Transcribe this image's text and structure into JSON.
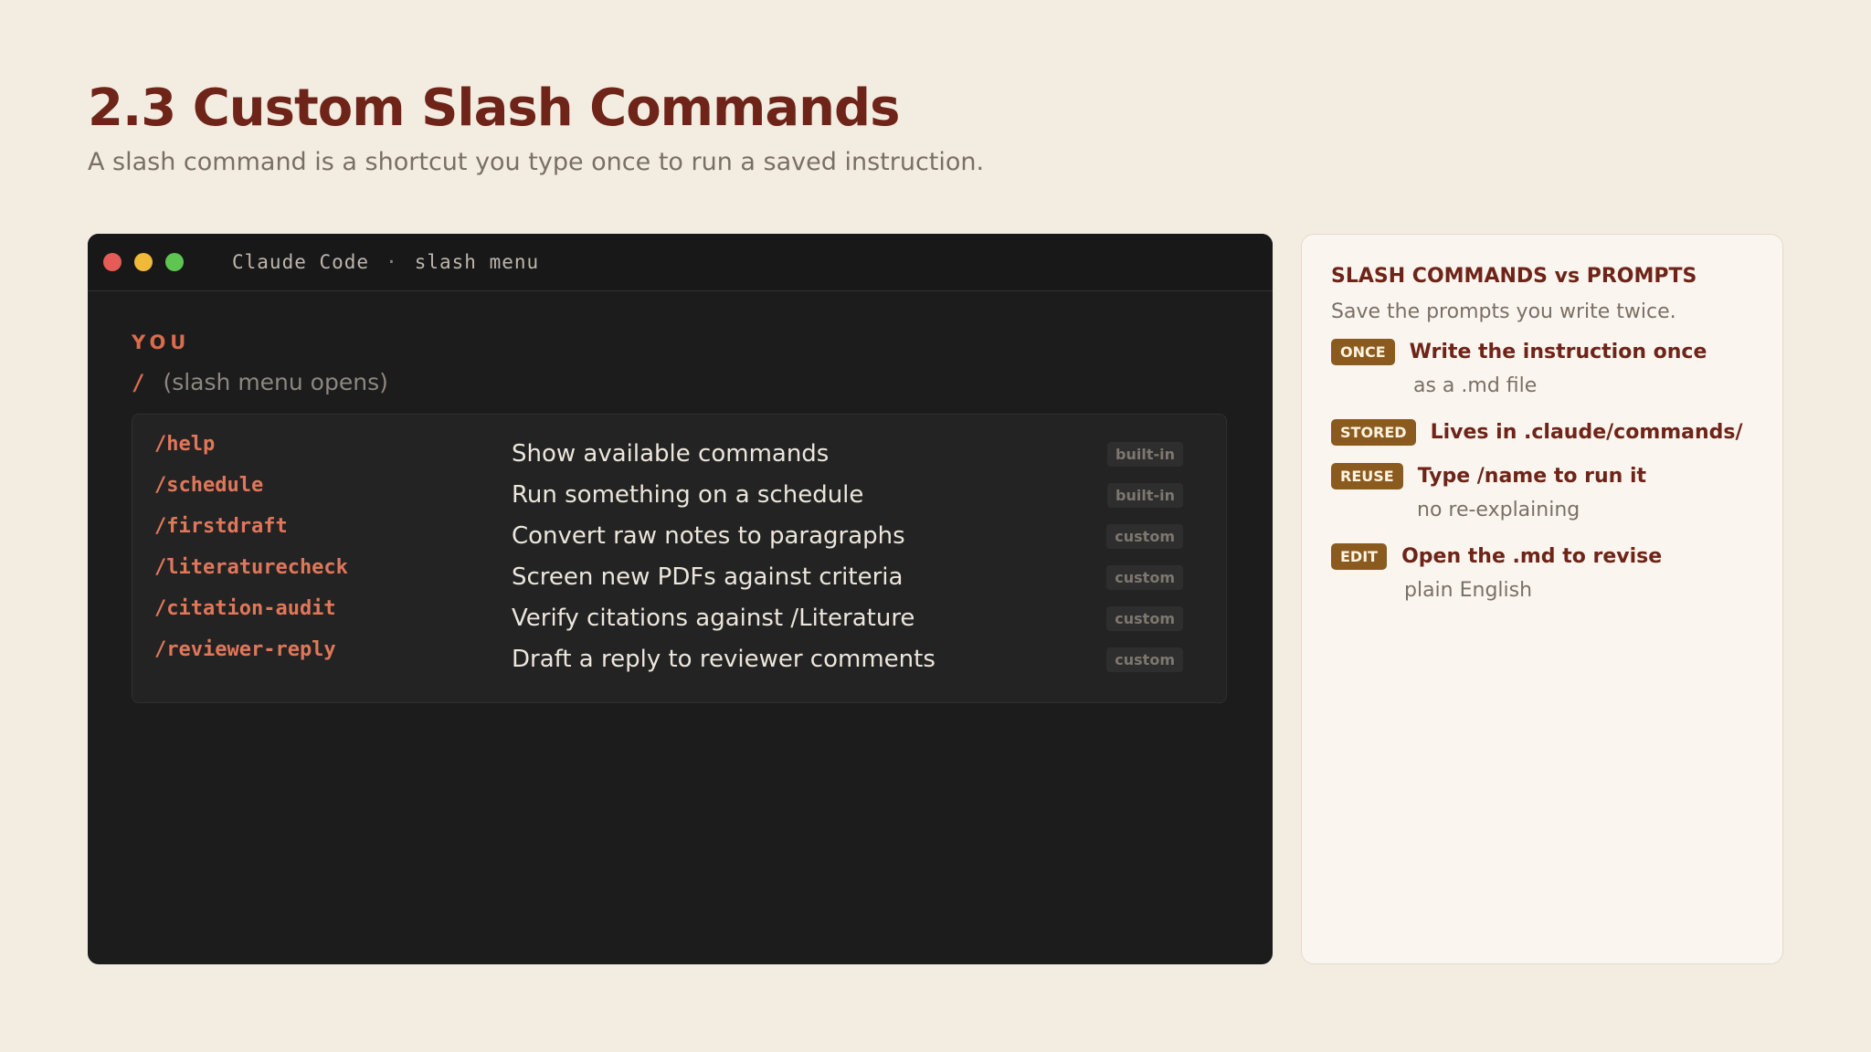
{
  "page": {
    "title": "2.3 Custom Slash Commands",
    "subtitle": "A slash command is a shortcut you type once to run a saved instruction."
  },
  "terminal": {
    "app_name": "Claude Code",
    "separator": "·",
    "view_name": "slash menu",
    "window_controls": [
      "close",
      "minimize",
      "maximize"
    ],
    "speaker_label": "YOU",
    "prompt_input": "/",
    "prompt_hint": "(slash menu opens)",
    "commands": [
      {
        "command": "/help",
        "description": "Show available commands",
        "tag": "built-in"
      },
      {
        "command": "/schedule",
        "description": "Run something on a schedule",
        "tag": "built-in"
      },
      {
        "command": "/firstdraft",
        "description": "Convert raw notes to paragraphs",
        "tag": "custom"
      },
      {
        "command": "/literaturecheck",
        "description": "Screen new PDFs against criteria",
        "tag": "custom"
      },
      {
        "command": "/citation-audit",
        "description": "Verify citations against /Literature",
        "tag": "custom"
      },
      {
        "command": "/reviewer-reply",
        "description": "Draft a reply to reviewer comments",
        "tag": "custom"
      }
    ]
  },
  "card": {
    "title": "SLASH COMMANDS vs PROMPTS",
    "subtitle": "Save the prompts you write twice.",
    "items": [
      {
        "badge": "ONCE",
        "heading": "Write the instruction once",
        "note": "as a .md file"
      },
      {
        "badge": "STORED",
        "heading": "Lives in .claude/commands/",
        "note": ""
      },
      {
        "badge": "REUSE",
        "heading": "Type /name to run it",
        "note": "no re-explaining"
      },
      {
        "badge": "EDIT",
        "heading": "Open the .md to revise",
        "note": "plain English"
      }
    ]
  },
  "colors": {
    "background": "#f3ece1",
    "accent_dark_red": "#6e2418",
    "terminal_bg": "#1c1c1c",
    "command_orange": "#e0775a",
    "badge_brown": "#8b5a1f"
  }
}
